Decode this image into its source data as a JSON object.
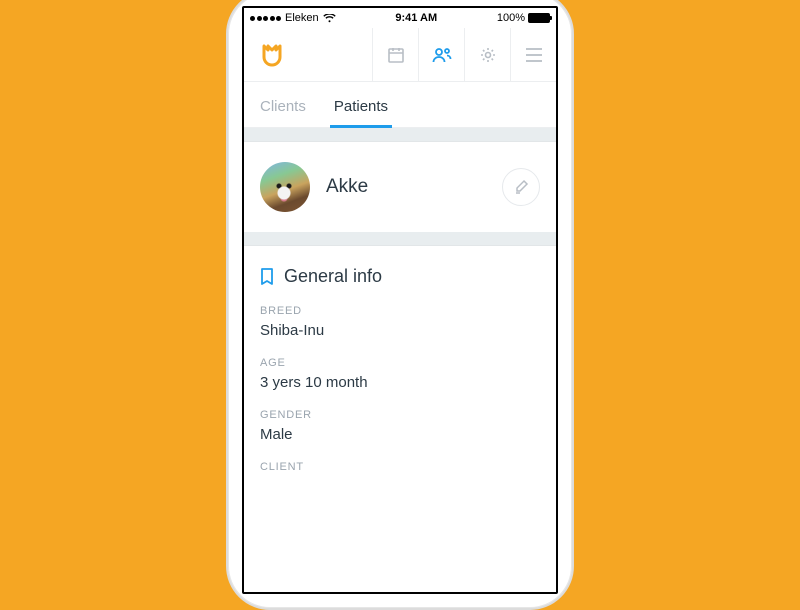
{
  "status": {
    "carrier": "Eleken",
    "time": "9:41 AM",
    "battery_pct": "100%"
  },
  "tabs": {
    "clients": "Clients",
    "patients": "Patients"
  },
  "patient": {
    "name": "Akke"
  },
  "section": {
    "title": "General info",
    "breed_label": "BREED",
    "breed_value": "Shiba-Inu",
    "age_label": "AGE",
    "age_value": "3 yers 10 month",
    "gender_label": "GENDER",
    "gender_value": "Male",
    "client_label": "CLIENT"
  }
}
